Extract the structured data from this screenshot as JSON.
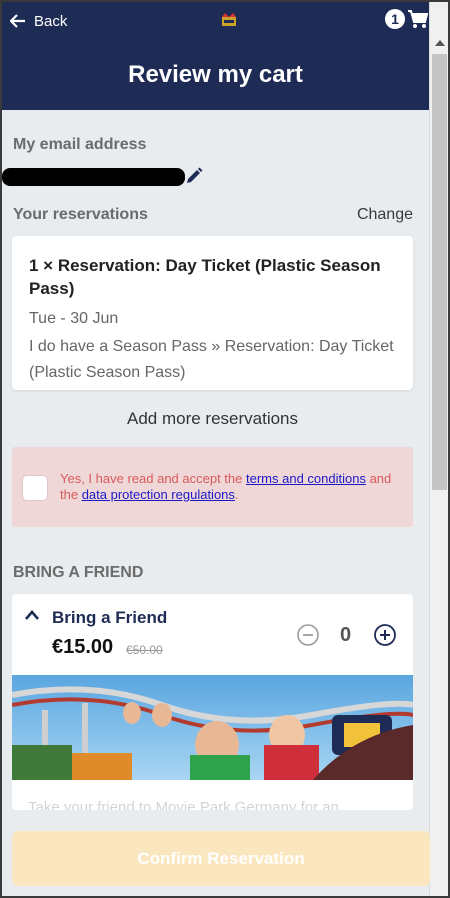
{
  "topbar": {
    "back_label": "Back",
    "cart_count": "1",
    "accent": "#1e2c55"
  },
  "header": {
    "title": "Review my cart"
  },
  "email": {
    "label": "My email address"
  },
  "reservations": {
    "label": "Your reservations",
    "change_label": "Change",
    "items": [
      {
        "title": "1 × Reservation: Day Ticket (Plastic Season Pass)",
        "date": "Tue - 30 Jun",
        "description": "I do have a Season Pass » Reservation: Day Ticket (Plastic Season Pass)"
      }
    ],
    "add_more_label": "Add more reservations"
  },
  "terms": {
    "prefix": "Yes, I have read and accept the ",
    "terms_link": "terms and conditions",
    "middle": " and the ",
    "privacy_link": "data protection regulations",
    "suffix": ".",
    "checked": false
  },
  "bring_friend": {
    "section_label": "BRING A FRIEND",
    "title": "Bring a Friend",
    "price": "€15.00",
    "old_price": "€50.00",
    "quantity": "0",
    "description": "Take your friend to Movie Park Germany for an"
  },
  "confirm": {
    "label": "Confirm Reservation",
    "color": "#fbe7bf"
  }
}
